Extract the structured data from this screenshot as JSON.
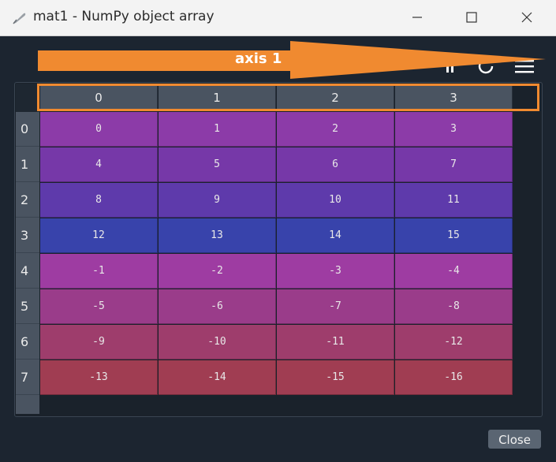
{
  "window": {
    "title": "mat1 - NumPy object array",
    "icon": "feather-icon"
  },
  "annotation": {
    "axis_label": "axis 1",
    "color": "#f08a30"
  },
  "toolbar": {
    "icons": [
      "cursor-icon",
      "refresh-icon",
      "menu-icon"
    ]
  },
  "table": {
    "column_headers": [
      "0",
      "1",
      "2",
      "3"
    ],
    "row_headers": [
      "0",
      "1",
      "2",
      "3",
      "4",
      "5",
      "6",
      "7"
    ],
    "rows": [
      [
        "0",
        "1",
        "2",
        "3"
      ],
      [
        "4",
        "5",
        "6",
        "7"
      ],
      [
        "8",
        "9",
        "10",
        "11"
      ],
      [
        "12",
        "13",
        "14",
        "15"
      ],
      [
        "-1",
        "-2",
        "-3",
        "-4"
      ],
      [
        "-5",
        "-6",
        "-7",
        "-8"
      ],
      [
        "-9",
        "-10",
        "-11",
        "-12"
      ],
      [
        "-13",
        "-14",
        "-15",
        "-16"
      ]
    ],
    "row_colors": [
      "#8c3ba8",
      "#7638a8",
      "#5e3aab",
      "#3843ab",
      "#9e3ca2",
      "#9a3c8a",
      "#9e3d6c",
      "#a03d52"
    ]
  },
  "buttons": {
    "close_label": "Close"
  }
}
